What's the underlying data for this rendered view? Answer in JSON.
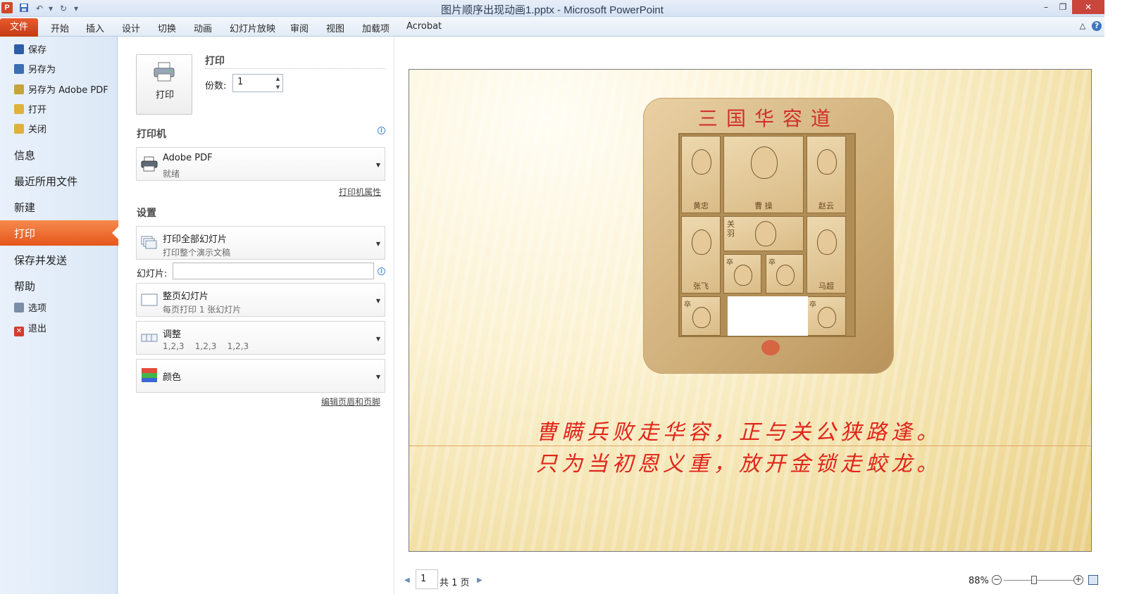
{
  "window": {
    "title": "图片顺序出现动画1.pptx - Microsoft PowerPoint",
    "app_icon": "P",
    "close_glyph": "✕",
    "restore_glyph": "❐",
    "minimize_glyph": "–"
  },
  "ribbon": {
    "file_tab": "文件",
    "tabs": [
      "开始",
      "插入",
      "设计",
      "切换",
      "动画",
      "幻灯片放映",
      "审阅",
      "视图",
      "加载项",
      "Acrobat"
    ],
    "help": "?",
    "minimize": "△"
  },
  "nav": {
    "small_items": [
      {
        "label": "保存",
        "icon": "save-icon",
        "color": "#2c5ea8"
      },
      {
        "label": "另存为",
        "icon": "save-as-icon",
        "color": "#3a6fb5"
      },
      {
        "label": "另存为 Adobe PDF",
        "icon": "adobe-pdf-icon",
        "color": "#c7a33a"
      },
      {
        "label": "打开",
        "icon": "open-folder-icon",
        "color": "#e0b23b"
      },
      {
        "label": "关闭",
        "icon": "close-folder-icon",
        "color": "#e0b23b"
      }
    ],
    "big_items": [
      "信息",
      "最近所用文件",
      "新建"
    ],
    "selected": "打印",
    "big_items_after": [
      "保存并发送",
      "帮助"
    ],
    "footer_items": [
      {
        "label": "选项",
        "icon": "options-icon",
        "color": "#7b8ea8"
      },
      {
        "label": "退出",
        "icon": "exit-icon",
        "color": "#d33b2f"
      }
    ]
  },
  "print": {
    "section_title": "打印",
    "button_label": "打印",
    "copies_label": "份数:",
    "copies_value": "1",
    "printer_section": "打印机",
    "printer_name": "Adobe PDF",
    "printer_status": "就绪",
    "printer_properties": "打印机属性",
    "settings_section": "设置",
    "range_main": "打印全部幻灯片",
    "range_sub": "打印整个演示文稿",
    "slides_label": "幻灯片:",
    "slides_value": "",
    "layout_main": "整页幻灯片",
    "layout_sub": "每页打印 1 张幻灯片",
    "collate_main": "调整",
    "collate_sub": "1,2,3    1,2,3    1,2,3",
    "color_main": "颜色",
    "edit_header_footer": "编辑页眉和页脚"
  },
  "preview": {
    "puzzle_title": "三国华容道",
    "pieces": {
      "huangzhong": "黄忠",
      "caocao": "曹 操",
      "zhaoyun": "赵云",
      "guanyu": "关羽",
      "zhangfei": "张飞",
      "machao": "马超",
      "soldier": "卒"
    },
    "poem_line1": "曹瞒兵败走华容，正与关公狭路逢。",
    "poem_line2": "只为当初恩义重，放开金锁走蛟龙。"
  },
  "footer": {
    "page_value": "1",
    "page_total": "共 1 页",
    "zoom": "88%",
    "zoom_minus": "−",
    "zoom_plus": "+"
  }
}
